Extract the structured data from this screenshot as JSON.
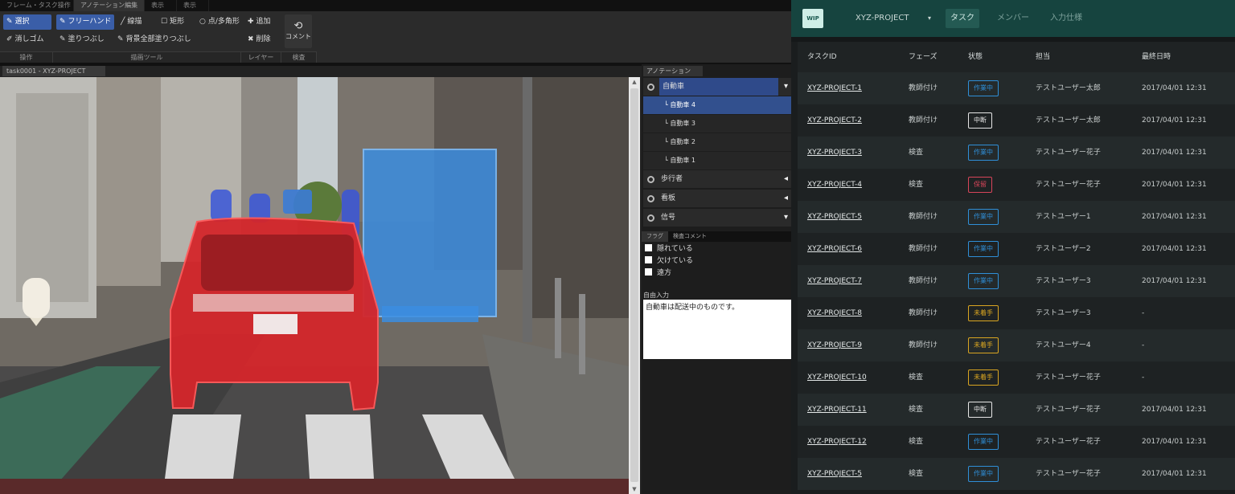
{
  "editor": {
    "menu_tabs": [
      "フレーム・タスク操作",
      "アノテーション編集",
      "表示",
      "表示"
    ],
    "tools": {
      "hand": "選択",
      "free": "フリーハンド",
      "line": "線描",
      "rect": "矩形",
      "circle": "点/多角形",
      "eraser": "消しゴム",
      "fill": "塗りつぶし",
      "fill_all": "背景全部塗りつぶし",
      "add": "追加",
      "delete": "削除",
      "comment": "コメント"
    },
    "group_labels": [
      "操作",
      "描画ツール",
      "レイヤー",
      "検査"
    ],
    "doc_tab": "task0001 - XYZ-PROJECT",
    "side_tab": "アノテーション",
    "categories": [
      {
        "label": "自動車",
        "open": true
      },
      {
        "label": "歩行者",
        "open": false
      },
      {
        "label": "看板",
        "open": false
      },
      {
        "label": "信号",
        "open": true
      }
    ],
    "instances": [
      "自動車 4",
      "自動車 3",
      "自動車 2",
      "自動車 1"
    ],
    "selected_instance": "自動車 4",
    "flag_tabs": [
      "フラグ",
      "検査コメント"
    ],
    "flags": [
      "隠れている",
      "欠けている",
      "遠方"
    ],
    "free_label": "自由入力",
    "free_text": "自動車は配送中のものです。"
  },
  "app": {
    "logo": "WIP",
    "project": "XYZ-PROJECT",
    "nav": [
      {
        "label": "タスク",
        "active": true
      },
      {
        "label": "メンバー",
        "active": false
      },
      {
        "label": "入力仕様",
        "active": false
      }
    ],
    "columns": [
      "タスクID",
      "フェーズ",
      "状態",
      "担当",
      "最終日時"
    ],
    "rows": [
      {
        "id": "XYZ-PROJECT-1",
        "phase": "教師付け",
        "status": "作業中",
        "assignee": "テストユーザー太郎",
        "date": "2017/04/01 12:31"
      },
      {
        "id": "XYZ-PROJECT-2",
        "phase": "教師付け",
        "status": "中断",
        "assignee": "テストユーザー太郎",
        "date": "2017/04/01 12:31"
      },
      {
        "id": "XYZ-PROJECT-3",
        "phase": "検査",
        "status": "作業中",
        "assignee": "テストユーザー花子",
        "date": "2017/04/01 12:31"
      },
      {
        "id": "XYZ-PROJECT-4",
        "phase": "検査",
        "status": "保留",
        "assignee": "テストユーザー花子",
        "date": "2017/04/01 12:31"
      },
      {
        "id": "XYZ-PROJECT-5",
        "phase": "教師付け",
        "status": "作業中",
        "assignee": "テストユーザー1",
        "date": "2017/04/01 12:31"
      },
      {
        "id": "XYZ-PROJECT-6",
        "phase": "教師付け",
        "status": "作業中",
        "assignee": "テストユーザー2",
        "date": "2017/04/01 12:31"
      },
      {
        "id": "XYZ-PROJECT-7",
        "phase": "教師付け",
        "status": "作業中",
        "assignee": "テストユーザー3",
        "date": "2017/04/01 12:31"
      },
      {
        "id": "XYZ-PROJECT-8",
        "phase": "教師付け",
        "status": "未着手",
        "assignee": "テストユーザー3",
        "date": "-"
      },
      {
        "id": "XYZ-PROJECT-9",
        "phase": "教師付け",
        "status": "未着手",
        "assignee": "テストユーザー4",
        "date": "-"
      },
      {
        "id": "XYZ-PROJECT-10",
        "phase": "検査",
        "status": "未着手",
        "assignee": "テストユーザー花子",
        "date": "-"
      },
      {
        "id": "XYZ-PROJECT-11",
        "phase": "検査",
        "status": "中断",
        "assignee": "テストユーザー花子",
        "date": "2017/04/01 12:31"
      },
      {
        "id": "XYZ-PROJECT-12",
        "phase": "検査",
        "status": "作業中",
        "assignee": "テストユーザー花子",
        "date": "2017/04/01 12:31"
      },
      {
        "id": "XYZ-PROJECT-5",
        "phase": "検査",
        "status": "作業中",
        "assignee": "テストユーザー花子",
        "date": "2017/04/01 12:31"
      }
    ],
    "status_colors": {
      "作業中": "#2f8fd8",
      "中断": "#e6e6e6",
      "保留": "#d8455a",
      "未着手": "#d9a521"
    }
  }
}
